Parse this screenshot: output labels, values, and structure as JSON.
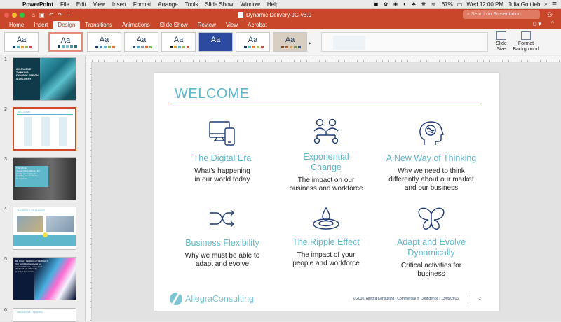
{
  "menubar": {
    "app_name": "PowerPoint",
    "items": [
      "File",
      "Edit",
      "View",
      "Insert",
      "Format",
      "Arrange",
      "Tools",
      "Slide Show",
      "Window",
      "Help"
    ],
    "battery": "67%",
    "clock": "Wed 12:00 PM",
    "user": "Julia Gottlieb"
  },
  "titlebar": {
    "document_title": "Dynamic Delivery-JG-v3.0",
    "search_placeholder": "Search in Presentation",
    "accent": "#c8462a"
  },
  "ribbon": {
    "tabs": [
      "Home",
      "Insert",
      "Design",
      "Transitions",
      "Animations",
      "Slide Show",
      "Review",
      "View",
      "Acrobat"
    ],
    "active_tab": "Design",
    "theme_label": "Aa",
    "buttons": {
      "slide_size": [
        "Slide",
        "Size"
      ],
      "format_background": [
        "Format",
        "Background"
      ]
    }
  },
  "thumbnails": [
    {
      "number": "1",
      "lines": [
        "INNOVATIVE",
        "THINKING:",
        "DYNAMIC DESIGN",
        "& DELIVERY"
      ]
    },
    {
      "number": "2",
      "lines": [
        "WELCOME"
      ]
    },
    {
      "number": "3",
      "lines": [
        "THE FACE",
        "\"If everything affected the",
        "people we engage as",
        "possible, we would not",
        "be anyone\""
      ]
    },
    {
      "number": "4",
      "lines": [
        "THE SPEED OF CHANGE"
      ]
    },
    {
      "number": "5",
      "lines": [
        "BE RIGHT HERE ALL THE RIGHT",
        "Our world is changing at an",
        "exponential rate, so we must",
        "think and act differently",
        "to adapt and evolve"
      ]
    },
    {
      "number": "6",
      "lines": [
        "INNOVATIVE THINKING"
      ]
    }
  ],
  "slide": {
    "title": "WELCOME",
    "items": [
      {
        "heading": "The Digital Era",
        "desc": [
          "What's happening",
          "in our world today"
        ]
      },
      {
        "heading": "Exponential Change",
        "heading_lines": [
          "Exponential",
          "Change"
        ],
        "desc": [
          "The impact on our",
          "business and workforce"
        ]
      },
      {
        "heading": "A New Way of Thinking",
        "desc": [
          "Why we need to think",
          "differently about our market",
          "and our business"
        ]
      },
      {
        "heading": "Business Flexibility",
        "desc": [
          "Why we must be able to",
          "adapt and evolve"
        ]
      },
      {
        "heading": "The Ripple Effect",
        "desc": [
          "The impact of your",
          "people and workforce"
        ]
      },
      {
        "heading": "Adapt and Evolve Dynamically",
        "heading_lines": [
          "Adapt and Evolve",
          "Dynamically"
        ],
        "desc": [
          "Critical activities for",
          "business"
        ]
      }
    ],
    "footer": {
      "logo_text": "AllegraConsulting",
      "text": "© 2016, Allegra Consulting | Commercial in Confidence | 13/09/2016",
      "page_number": "2"
    },
    "accent": "#5fb7cc",
    "icon_color": "#1f3b73"
  }
}
